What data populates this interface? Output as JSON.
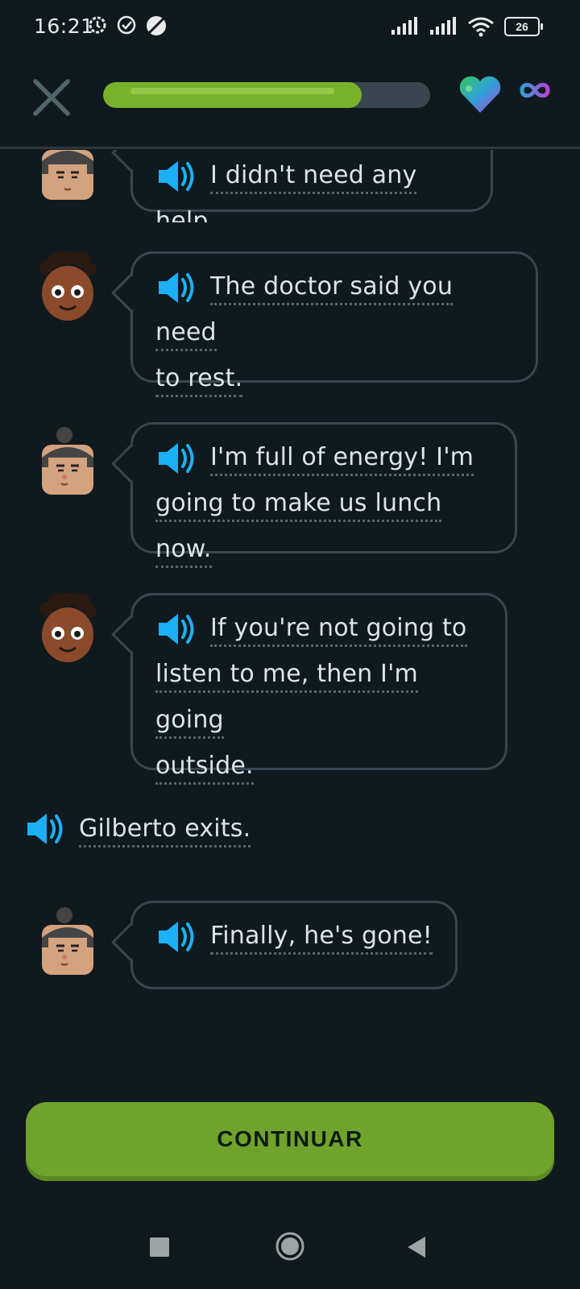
{
  "status_bar": {
    "time": "16:21",
    "battery": "26"
  },
  "header": {
    "progress_percent": 79,
    "hearts": "infinite",
    "colors": {
      "progress_fill": "#78b22b",
      "progress_track": "#37464f"
    }
  },
  "messages": [
    {
      "speaker": "man",
      "text": "I didn't need any help."
    },
    {
      "speaker": "woman",
      "text_line1": "The doctor said you need",
      "text_line2": "to rest."
    },
    {
      "speaker": "man",
      "text_line1": "I'm full of energy! I'm",
      "text_line2": "going to make us lunch now."
    },
    {
      "speaker": "woman",
      "text_line1": "If you're not going to",
      "text_line2": "listen to me, then I'm going",
      "text_line3": "outside."
    },
    {
      "speaker": "man",
      "text": "Finally, he's gone!"
    }
  ],
  "narration": {
    "text": "Gilberto exits."
  },
  "footer": {
    "continue_label": "CONTINUAR"
  },
  "icons": [
    "close-icon",
    "heart-icon",
    "infinity-icon",
    "speaker-icon",
    "stop-icon",
    "home-icon",
    "back-icon"
  ]
}
